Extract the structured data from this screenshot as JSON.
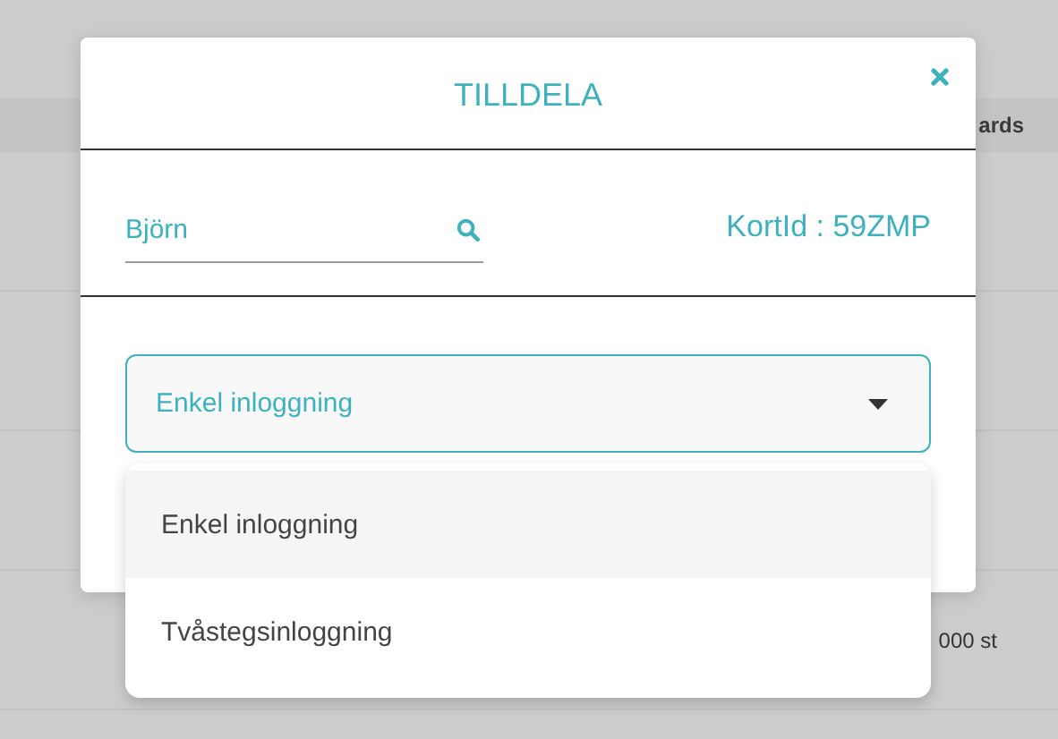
{
  "background": {
    "column_header": "ards",
    "rows": [
      {
        "cell": ""
      },
      {
        "cell": ""
      },
      {
        "cell": ""
      },
      {
        "cell": "000 st"
      }
    ]
  },
  "dialog": {
    "title": "TILLDELA",
    "search": {
      "value": "Björn"
    },
    "card_id": "KortId : 59ZMP",
    "select": {
      "value": "Enkel inloggning",
      "expanded": true
    },
    "options": [
      {
        "label": "Enkel inloggning",
        "selected": true
      },
      {
        "label": "Tvåstegsinloggning",
        "selected": false
      }
    ]
  }
}
